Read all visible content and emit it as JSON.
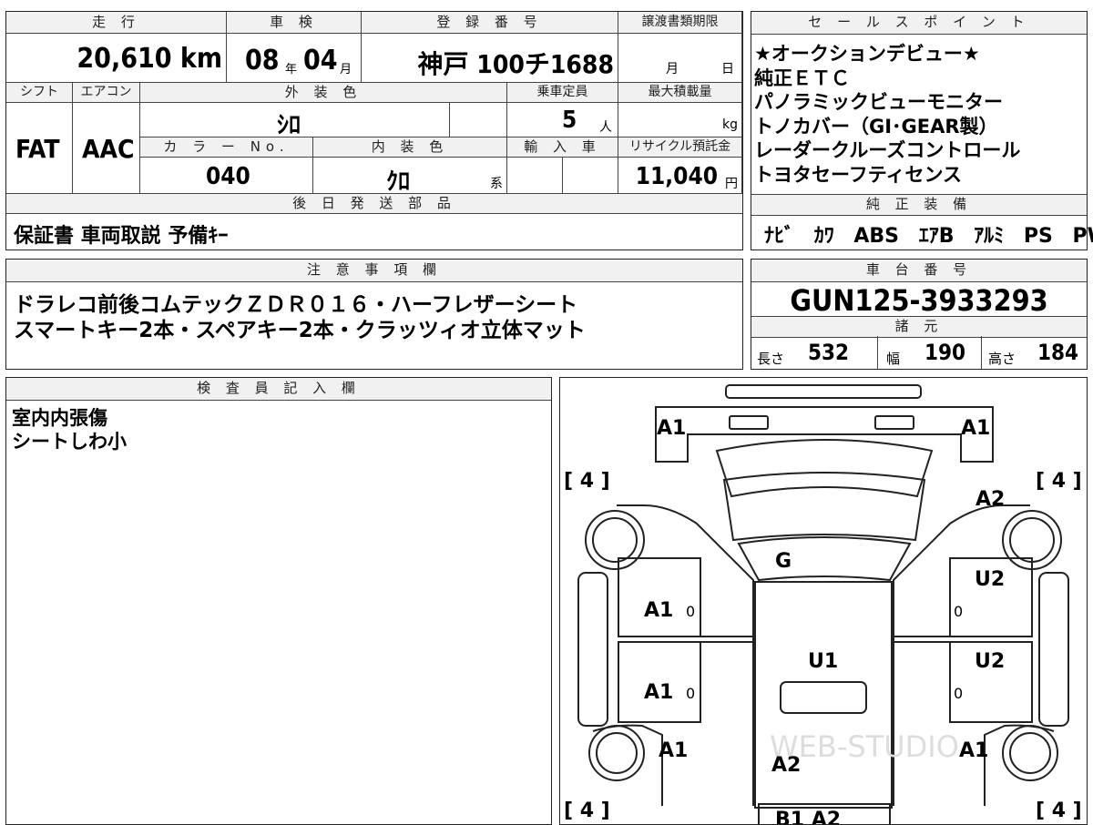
{
  "vehicle": {
    "mileage_header": "走 行",
    "mileage_value": "20,610 km",
    "inspection_header": "車 検",
    "inspection_year": "08",
    "inspection_year_unit": "年",
    "inspection_month": "04",
    "inspection_month_unit": "月",
    "registration_header": "登 録 番 号",
    "registration_value": "神戸 100チ1688",
    "transfer_header": "譲渡書類期限",
    "transfer_month_unit": "月",
    "transfer_day_unit": "日",
    "shift_header": "シフト",
    "shift_value": "FAT",
    "aircon_header": "エアコン",
    "aircon_value": "AAC",
    "exterior_header": "外 装 色",
    "exterior_value": "ｼﾛ",
    "capacity_header": "乗車定員",
    "capacity_value": "5",
    "capacity_unit": "人",
    "maxload_header": "最大積載量",
    "maxload_unit": "kg",
    "color_no_header": "カ ラ ー No.",
    "color_no_value": "040",
    "interior_header": "内 装 色",
    "interior_value": "ｸﾛ",
    "interior_unit": "系",
    "import_header": "輸 入 車",
    "recycle_header": "リサイクル預託金",
    "recycle_value": "11,040",
    "recycle_unit": "円",
    "later_parts_header": "後 日 発 送 部 品",
    "later_parts_value": "保証書 車両取説 予備ｷｰ"
  },
  "sales_points": {
    "header": "セ ー ル ス ポ イ ン ト",
    "items": [
      "★オークションデビュー★",
      "純正ＥＴＣ",
      "パノラミックビューモニター",
      "トノカバー（GI･GEAR製）",
      "レーダークルーズコントロール",
      "トヨタセーフティセンス"
    ]
  },
  "equipment": {
    "header": "純 正 装 備",
    "items": [
      "ﾅﾋﾞ",
      "ｶﾜ",
      "ABS",
      "ｴｱB",
      "ｱﾙﾐ",
      "PS",
      "PW"
    ]
  },
  "notes": {
    "header": "注 意 事 項 欄",
    "lines": [
      "ドラレコ前後コムテックＺＤＲ０１６・ハーフレザーシート",
      "スマートキー2本・スペアキー2本・クラッツィオ立体マット"
    ]
  },
  "chassis": {
    "header": "車 台 番 号",
    "value": "GUN125-3933293"
  },
  "specs": {
    "header": "諸 元",
    "length_label": "長さ",
    "length_value": "532",
    "width_label": "幅",
    "width_value": "190",
    "height_label": "高さ",
    "height_value": "184"
  },
  "inspector": {
    "header": "検 査 員 記 入 欄",
    "lines": [
      "室内内張傷",
      "シートしわ小"
    ]
  },
  "diagram": {
    "marks": {
      "front_left": "A1",
      "front_right": "A1",
      "fender_right": "A2",
      "tire_fl": "[ 4 ]",
      "tire_fr": "[ 4 ]",
      "windshield": "G",
      "door_fl": "A1",
      "door_fr": "U2",
      "roof": "U1",
      "door_rl": "A1",
      "door_rr": "U2",
      "rear_left": "A1",
      "rear_right": "A1",
      "rear_center": "A2",
      "tire_rl": "[ 4 ]",
      "tire_rr": "[ 4 ]",
      "zero_1": "0",
      "zero_2": "0",
      "zero_3": "0",
      "zero_4": "0",
      "bottom_center": "B1 A2"
    },
    "watermark": "WEB-STUDIO"
  }
}
